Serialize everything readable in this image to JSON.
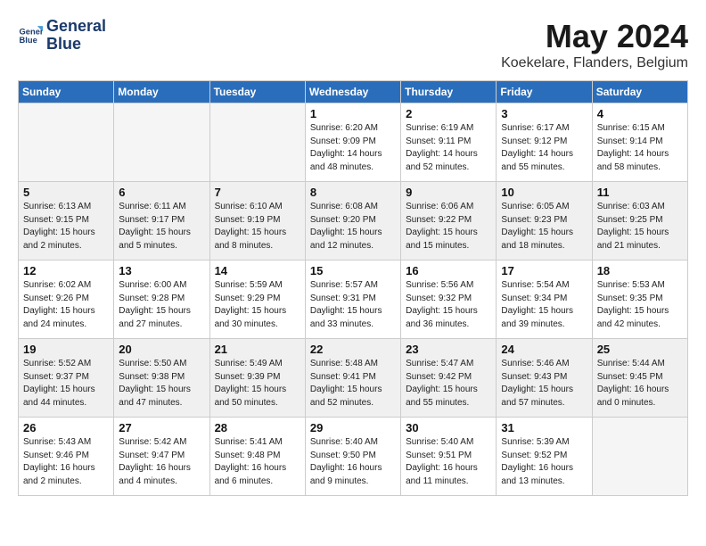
{
  "header": {
    "logo_line1": "General",
    "logo_line2": "Blue",
    "month_title": "May 2024",
    "location": "Koekelare, Flanders, Belgium"
  },
  "weekdays": [
    "Sunday",
    "Monday",
    "Tuesday",
    "Wednesday",
    "Thursday",
    "Friday",
    "Saturday"
  ],
  "weeks": [
    [
      {
        "day": "",
        "info": "",
        "empty": true
      },
      {
        "day": "",
        "info": "",
        "empty": true
      },
      {
        "day": "",
        "info": "",
        "empty": true
      },
      {
        "day": "1",
        "info": "Sunrise: 6:20 AM\nSunset: 9:09 PM\nDaylight: 14 hours\nand 48 minutes."
      },
      {
        "day": "2",
        "info": "Sunrise: 6:19 AM\nSunset: 9:11 PM\nDaylight: 14 hours\nand 52 minutes."
      },
      {
        "day": "3",
        "info": "Sunrise: 6:17 AM\nSunset: 9:12 PM\nDaylight: 14 hours\nand 55 minutes."
      },
      {
        "day": "4",
        "info": "Sunrise: 6:15 AM\nSunset: 9:14 PM\nDaylight: 14 hours\nand 58 minutes."
      }
    ],
    [
      {
        "day": "5",
        "info": "Sunrise: 6:13 AM\nSunset: 9:15 PM\nDaylight: 15 hours\nand 2 minutes."
      },
      {
        "day": "6",
        "info": "Sunrise: 6:11 AM\nSunset: 9:17 PM\nDaylight: 15 hours\nand 5 minutes."
      },
      {
        "day": "7",
        "info": "Sunrise: 6:10 AM\nSunset: 9:19 PM\nDaylight: 15 hours\nand 8 minutes."
      },
      {
        "day": "8",
        "info": "Sunrise: 6:08 AM\nSunset: 9:20 PM\nDaylight: 15 hours\nand 12 minutes."
      },
      {
        "day": "9",
        "info": "Sunrise: 6:06 AM\nSunset: 9:22 PM\nDaylight: 15 hours\nand 15 minutes."
      },
      {
        "day": "10",
        "info": "Sunrise: 6:05 AM\nSunset: 9:23 PM\nDaylight: 15 hours\nand 18 minutes."
      },
      {
        "day": "11",
        "info": "Sunrise: 6:03 AM\nSunset: 9:25 PM\nDaylight: 15 hours\nand 21 minutes."
      }
    ],
    [
      {
        "day": "12",
        "info": "Sunrise: 6:02 AM\nSunset: 9:26 PM\nDaylight: 15 hours\nand 24 minutes."
      },
      {
        "day": "13",
        "info": "Sunrise: 6:00 AM\nSunset: 9:28 PM\nDaylight: 15 hours\nand 27 minutes."
      },
      {
        "day": "14",
        "info": "Sunrise: 5:59 AM\nSunset: 9:29 PM\nDaylight: 15 hours\nand 30 minutes."
      },
      {
        "day": "15",
        "info": "Sunrise: 5:57 AM\nSunset: 9:31 PM\nDaylight: 15 hours\nand 33 minutes."
      },
      {
        "day": "16",
        "info": "Sunrise: 5:56 AM\nSunset: 9:32 PM\nDaylight: 15 hours\nand 36 minutes."
      },
      {
        "day": "17",
        "info": "Sunrise: 5:54 AM\nSunset: 9:34 PM\nDaylight: 15 hours\nand 39 minutes."
      },
      {
        "day": "18",
        "info": "Sunrise: 5:53 AM\nSunset: 9:35 PM\nDaylight: 15 hours\nand 42 minutes."
      }
    ],
    [
      {
        "day": "19",
        "info": "Sunrise: 5:52 AM\nSunset: 9:37 PM\nDaylight: 15 hours\nand 44 minutes."
      },
      {
        "day": "20",
        "info": "Sunrise: 5:50 AM\nSunset: 9:38 PM\nDaylight: 15 hours\nand 47 minutes."
      },
      {
        "day": "21",
        "info": "Sunrise: 5:49 AM\nSunset: 9:39 PM\nDaylight: 15 hours\nand 50 minutes."
      },
      {
        "day": "22",
        "info": "Sunrise: 5:48 AM\nSunset: 9:41 PM\nDaylight: 15 hours\nand 52 minutes."
      },
      {
        "day": "23",
        "info": "Sunrise: 5:47 AM\nSunset: 9:42 PM\nDaylight: 15 hours\nand 55 minutes."
      },
      {
        "day": "24",
        "info": "Sunrise: 5:46 AM\nSunset: 9:43 PM\nDaylight: 15 hours\nand 57 minutes."
      },
      {
        "day": "25",
        "info": "Sunrise: 5:44 AM\nSunset: 9:45 PM\nDaylight: 16 hours\nand 0 minutes."
      }
    ],
    [
      {
        "day": "26",
        "info": "Sunrise: 5:43 AM\nSunset: 9:46 PM\nDaylight: 16 hours\nand 2 minutes."
      },
      {
        "day": "27",
        "info": "Sunrise: 5:42 AM\nSunset: 9:47 PM\nDaylight: 16 hours\nand 4 minutes."
      },
      {
        "day": "28",
        "info": "Sunrise: 5:41 AM\nSunset: 9:48 PM\nDaylight: 16 hours\nand 6 minutes."
      },
      {
        "day": "29",
        "info": "Sunrise: 5:40 AM\nSunset: 9:50 PM\nDaylight: 16 hours\nand 9 minutes."
      },
      {
        "day": "30",
        "info": "Sunrise: 5:40 AM\nSunset: 9:51 PM\nDaylight: 16 hours\nand 11 minutes."
      },
      {
        "day": "31",
        "info": "Sunrise: 5:39 AM\nSunset: 9:52 PM\nDaylight: 16 hours\nand 13 minutes."
      },
      {
        "day": "",
        "info": "",
        "empty": true
      }
    ]
  ]
}
